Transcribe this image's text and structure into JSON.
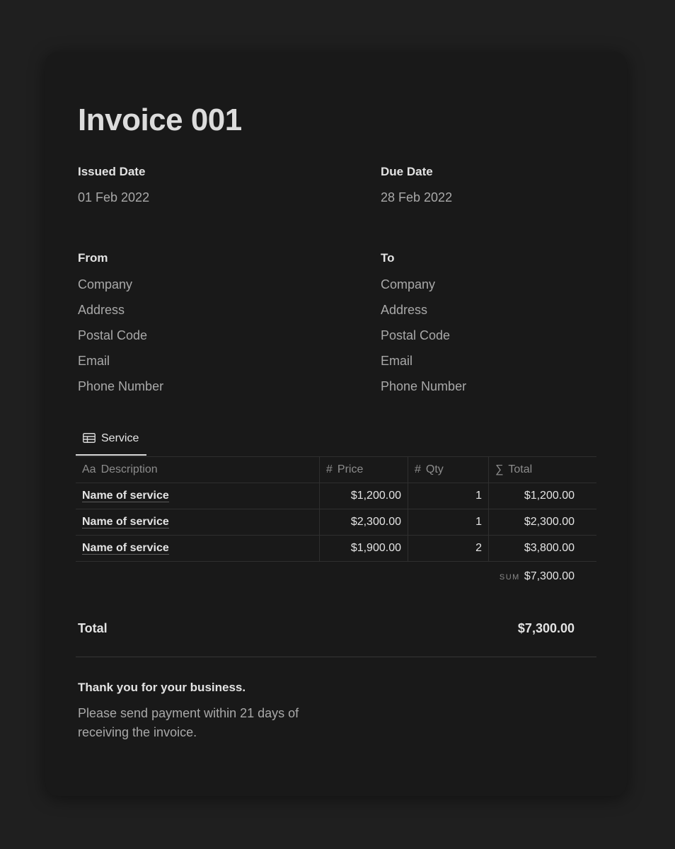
{
  "invoice": {
    "title": "Invoice 001",
    "issued": {
      "label": "Issued Date",
      "value": "01 Feb 2022"
    },
    "due": {
      "label": "Due Date",
      "value": "28 Feb 2022"
    },
    "from": {
      "label": "From",
      "company": "Company",
      "address": "Address",
      "postal": "Postal Code",
      "email": "Email",
      "phone": "Phone Number"
    },
    "to": {
      "label": "To",
      "company": "Company",
      "address": "Address",
      "postal": "Postal Code",
      "email": "Email",
      "phone": "Phone Number"
    }
  },
  "service": {
    "tab_label": "Service",
    "tab_icon": "table-icon",
    "columns": [
      {
        "icon": "Aa",
        "label": "Description"
      },
      {
        "icon": "#",
        "label": "Price"
      },
      {
        "icon": "#",
        "label": "Qty"
      },
      {
        "icon": "∑",
        "label": "Total"
      }
    ],
    "rows": [
      {
        "description": "Name of service",
        "price": "$1,200.00",
        "qty": "1",
        "total": "$1,200.00"
      },
      {
        "description": "Name of service",
        "price": "$2,300.00",
        "qty": "1",
        "total": "$2,300.00"
      },
      {
        "description": "Name of service",
        "price": "$1,900.00",
        "qty": "2",
        "total": "$3,800.00"
      }
    ],
    "sum_label": "SUM",
    "sum_value": "$7,300.00"
  },
  "summary": {
    "total_label": "Total",
    "total_value": "$7,300.00",
    "thanks": "Thank you for your business.",
    "note": "Please send payment within 21 days of receiving the invoice."
  },
  "colors": {
    "background": "#1f1f1f",
    "card": "#191919",
    "text_primary": "#e3e3e3",
    "text_secondary": "#a9a9a9"
  }
}
